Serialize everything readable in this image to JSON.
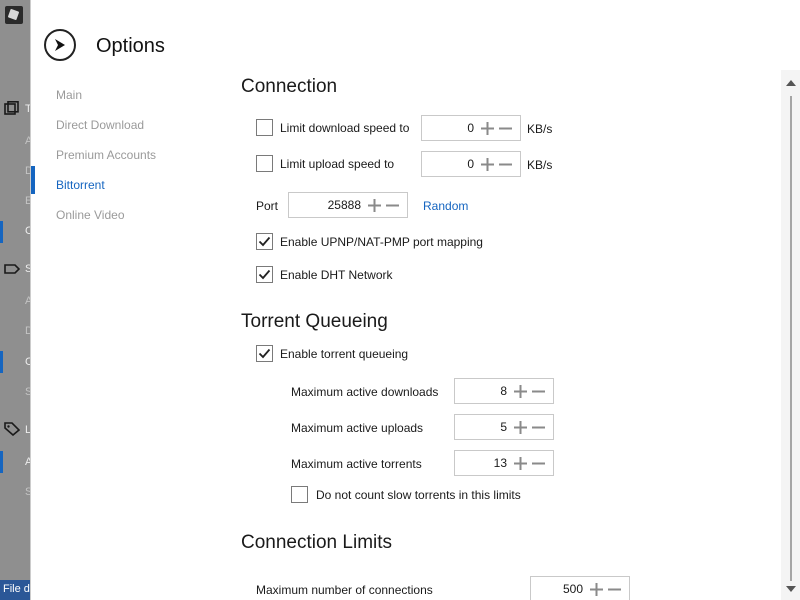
{
  "background_app": {
    "status_text": "File d",
    "items": [
      {
        "label": "T",
        "dim": false
      },
      {
        "label": "A",
        "dim": true
      },
      {
        "label": "D",
        "dim": true
      },
      {
        "label": "E",
        "dim": true
      },
      {
        "label": "C",
        "dim": false
      },
      {
        "label": "S",
        "dim": false
      },
      {
        "label": "A",
        "dim": true
      },
      {
        "label": "D",
        "dim": true
      },
      {
        "label": "C",
        "dim": false
      },
      {
        "label": "S",
        "dim": true
      },
      {
        "label": "L",
        "dim": false
      },
      {
        "label": "A",
        "dim": false
      },
      {
        "label": "S",
        "dim": true
      }
    ]
  },
  "dialog": {
    "title": "Options",
    "nav": [
      {
        "label": "Main",
        "active": false
      },
      {
        "label": "Direct Download",
        "active": false
      },
      {
        "label": "Premium Accounts",
        "active": false
      },
      {
        "label": "Bittorrent",
        "active": true
      },
      {
        "label": "Online Video",
        "active": false
      }
    ]
  },
  "connection": {
    "heading": "Connection",
    "download_limit": {
      "label": "Limit download speed to",
      "checked": false,
      "value": "0",
      "unit": "KB/s"
    },
    "upload_limit": {
      "label": "Limit upload speed to",
      "checked": false,
      "value": "0",
      "unit": "KB/s"
    },
    "port": {
      "label": "Port",
      "value": "25888",
      "random_label": "Random"
    },
    "upnp": {
      "label": "Enable UPNP/NAT-PMP port mapping",
      "checked": true
    },
    "dht": {
      "label": "Enable DHT Network",
      "checked": true
    }
  },
  "queueing": {
    "heading": "Torrent Queueing",
    "enable": {
      "label": "Enable torrent queueing",
      "checked": true
    },
    "max_downloads": {
      "label": "Maximum active downloads",
      "value": "8"
    },
    "max_uploads": {
      "label": "Maximum active uploads",
      "value": "5"
    },
    "max_torrents": {
      "label": "Maximum active torrents",
      "value": "13"
    },
    "slow": {
      "label": "Do not count slow torrents in this limits",
      "checked": false
    }
  },
  "limits": {
    "heading": "Connection Limits",
    "max_connections": {
      "label": "Maximum number of connections",
      "value": "500"
    }
  },
  "colors": {
    "accent": "#1565c0",
    "text": "#1a1a1a",
    "nav_inactive": "#9a9a9a"
  }
}
